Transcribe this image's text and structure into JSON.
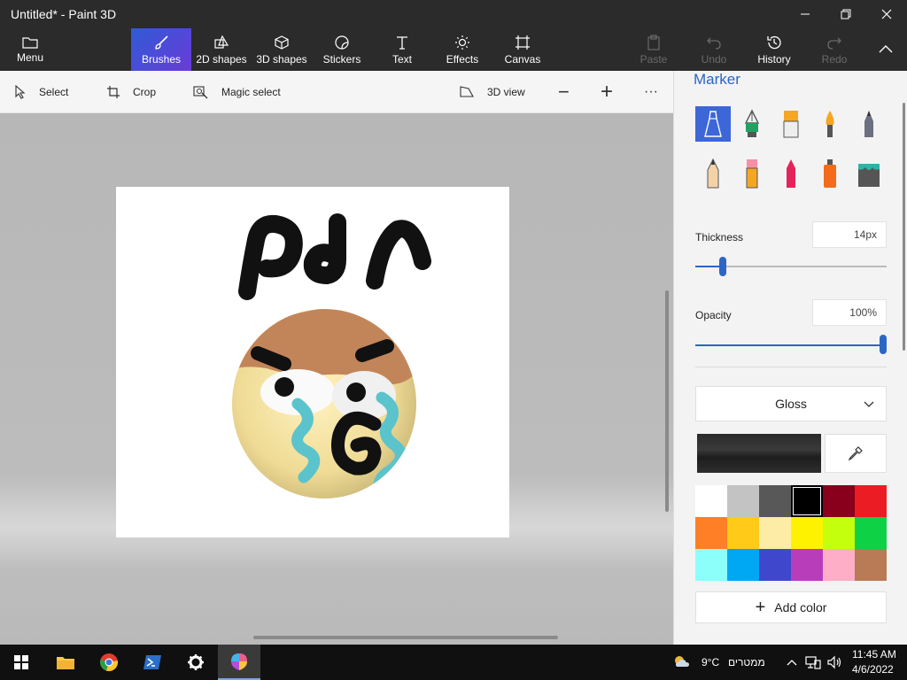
{
  "window": {
    "title": "Untitled* - Paint 3D"
  },
  "ribbon": {
    "menu": "Menu",
    "tabs": [
      "Brushes",
      "2D shapes",
      "3D shapes",
      "Stickers",
      "Text",
      "Effects",
      "Canvas"
    ],
    "actions": [
      "Paste",
      "Undo",
      "History",
      "Redo"
    ]
  },
  "toolbar": {
    "select": "Select",
    "crop": "Crop",
    "magic_select": "Magic select",
    "view_3d": "3D view",
    "zoom_out": "−",
    "zoom_in": "+",
    "more": "···"
  },
  "panel": {
    "title": "Marker",
    "thickness_label": "Thickness",
    "thickness_value": "14px",
    "opacity_label": "Opacity",
    "opacity_value": "100%",
    "finish": "Gloss",
    "add_color": "Add color"
  },
  "palette": [
    "#ffffff",
    "#c3c3c3",
    "#585858",
    "#000000",
    "#88001b",
    "#ec1c24",
    "#ff7f27",
    "#ffca18",
    "#fdeca6",
    "#fff200",
    "#c4ff0e",
    "#0ed145",
    "#8cfffb",
    "#00a8f3",
    "#3f48cc",
    "#b83dba",
    "#ffaec8",
    "#b97a56"
  ],
  "taskbar": {
    "weather": "9°C",
    "weather_desc": "ממטרים",
    "time": "11:45 AM",
    "date": "4/6/2022"
  }
}
